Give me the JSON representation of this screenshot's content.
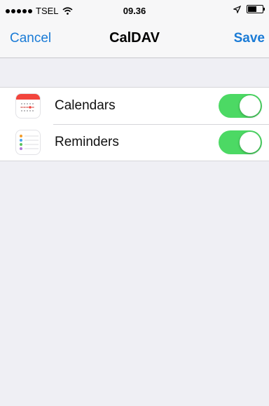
{
  "status_bar": {
    "carrier": "TSEL",
    "time": "09.36",
    "signal_icon": "signal-dots-icon",
    "wifi_icon": "wifi-icon",
    "location_icon": "location-arrow-icon",
    "battery_icon": "battery-icon"
  },
  "nav": {
    "cancel_label": "Cancel",
    "title": "CalDAV",
    "save_label": "Save"
  },
  "settings": {
    "items": [
      {
        "label": "Calendars",
        "icon": "calendar-app-icon",
        "enabled": true
      },
      {
        "label": "Reminders",
        "icon": "reminders-app-icon",
        "enabled": true
      }
    ]
  },
  "colors": {
    "accent": "#1a7bd6",
    "toggle_on": "#4cd964",
    "background": "#efeff4"
  }
}
